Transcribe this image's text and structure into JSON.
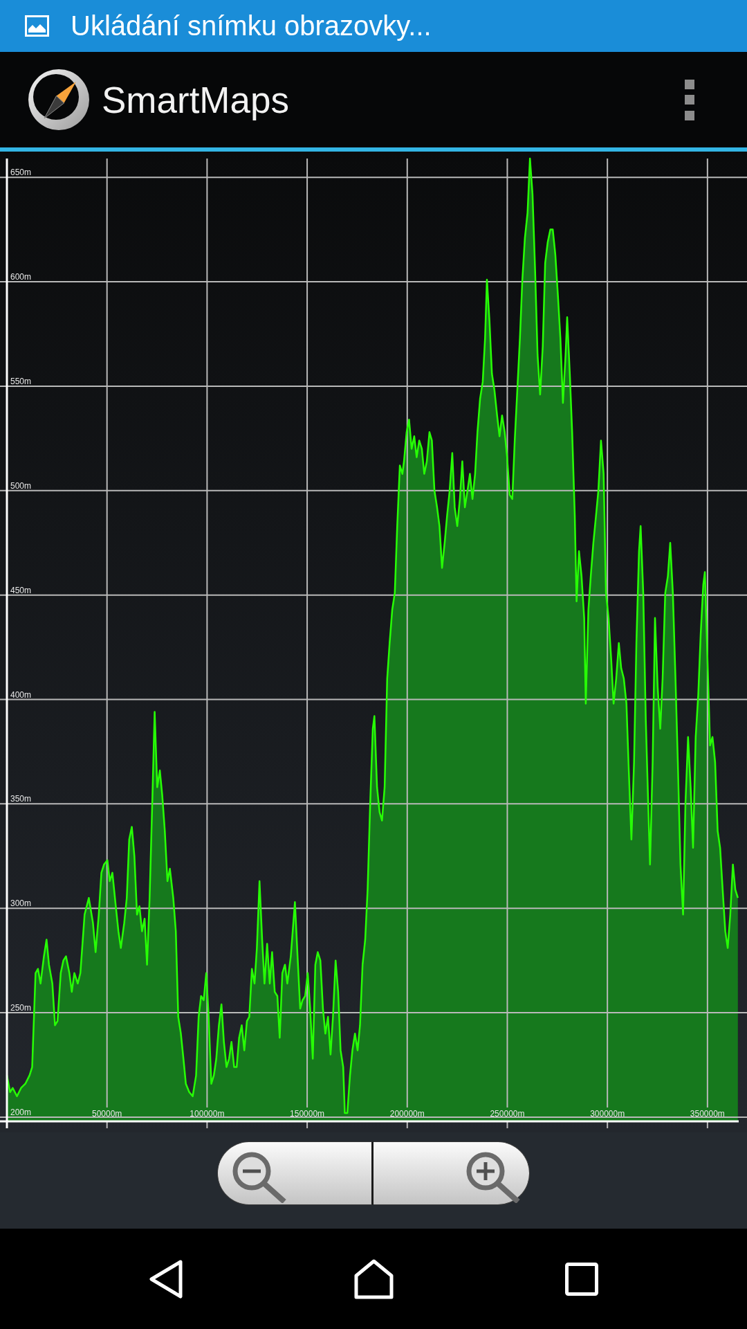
{
  "status_bar": {
    "notification": "Ukládání snímku obrazovky..."
  },
  "app_bar": {
    "title": "SmartMaps"
  },
  "elevation_chart": {
    "chart_data": {
      "type": "area",
      "grid": true,
      "xlim": [
        0,
        365600
      ],
      "ylim": [
        198,
        661
      ],
      "xticks": [
        {
          "value": 50000,
          "label": "50000m"
        },
        {
          "value": 100000,
          "label": "100000m"
        },
        {
          "value": 150000,
          "label": "150000m"
        },
        {
          "value": 200000,
          "label": "200000m"
        },
        {
          "value": 250000,
          "label": "250000m"
        },
        {
          "value": 300000,
          "label": "300000m"
        },
        {
          "value": 350000,
          "label": "350000m"
        }
      ],
      "yticks": [
        {
          "value": 200,
          "label": "200m"
        },
        {
          "value": 250,
          "label": "250m"
        },
        {
          "value": 300,
          "label": "300m"
        },
        {
          "value": 350,
          "label": "350m"
        },
        {
          "value": 400,
          "label": "400m"
        },
        {
          "value": 450,
          "label": "450m"
        },
        {
          "value": 500,
          "label": "500m"
        },
        {
          "value": 550,
          "label": "550m"
        },
        {
          "value": 600,
          "label": "600m"
        },
        {
          "value": 650,
          "label": "650m"
        }
      ],
      "x": [
        0,
        1600,
        2900,
        5000,
        7100,
        9200,
        11300,
        12600,
        14300,
        15500,
        16800,
        18500,
        19800,
        21000,
        22700,
        24000,
        25300,
        26900,
        28200,
        29500,
        31200,
        32400,
        33700,
        35400,
        36700,
        38800,
        40900,
        43000,
        44300,
        45900,
        47200,
        48500,
        50200,
        51400,
        52700,
        54400,
        55700,
        56900,
        58600,
        59900,
        61100,
        62400,
        63700,
        65000,
        66200,
        67500,
        68800,
        70000,
        71300,
        72600,
        73800,
        75100,
        76400,
        77600,
        78900,
        80200,
        81400,
        83100,
        84400,
        85600,
        86900,
        88200,
        89400,
        91100,
        92800,
        94500,
        95800,
        97000,
        98300,
        99600,
        100800,
        102100,
        103400,
        104600,
        105900,
        107200,
        108400,
        109700,
        111000,
        112200,
        113500,
        114800,
        116000,
        117300,
        118600,
        119900,
        121100,
        122400,
        123700,
        124900,
        126200,
        127500,
        128700,
        130000,
        131300,
        132500,
        133800,
        135100,
        136300,
        137600,
        138900,
        140100,
        141800,
        143100,
        143900,
        145200,
        146500,
        147700,
        149000,
        150300,
        151500,
        152800,
        154100,
        155300,
        156600,
        157900,
        159100,
        160400,
        161700,
        162900,
        164200,
        165500,
        166700,
        168000,
        168800,
        170100,
        171400,
        172600,
        173900,
        175200,
        176400,
        177700,
        179000,
        180200,
        181500,
        182800,
        183600,
        184900,
        186200,
        187400,
        188700,
        190000,
        191200,
        192500,
        193800,
        195000,
        196300,
        197600,
        198400,
        199700,
        200900,
        202200,
        203500,
        204700,
        206000,
        207300,
        208500,
        209800,
        211100,
        212300,
        213600,
        214900,
        216100,
        217400,
        218700,
        219900,
        221200,
        222500,
        223700,
        225000,
        226300,
        227500,
        228800,
        230100,
        231300,
        232600,
        233900,
        235100,
        236400,
        237700,
        238900,
        239800,
        241100,
        242300,
        243600,
        244900,
        246100,
        247400,
        248700,
        249900,
        251200,
        252500,
        253700,
        255000,
        256300,
        257500,
        258800,
        260100,
        261300,
        262600,
        263900,
        265100,
        266400,
        267700,
        268900,
        270200,
        271500,
        272700,
        274000,
        275300,
        276500,
        277800,
        279100,
        279900,
        281200,
        282400,
        283700,
        284600,
        285800,
        287100,
        288400,
        289200,
        290500,
        291700,
        293000,
        294300,
        295500,
        296800,
        298100,
        299300,
        300600,
        301900,
        303100,
        304400,
        305700,
        306900,
        308200,
        309500,
        310700,
        312000,
        313300,
        314500,
        315800,
        316600,
        317900,
        319200,
        320500,
        321300,
        322600,
        323800,
        325100,
        326400,
        327600,
        328900,
        330200,
        331400,
        332700,
        334000,
        335200,
        336500,
        337800,
        339000,
        340300,
        341600,
        342800,
        344100,
        345400,
        346600,
        347900,
        348700,
        350000,
        351300,
        352500,
        353800,
        355100,
        356300,
        357600,
        358900,
        360100,
        361400,
        362700,
        363900,
        365200
      ],
      "series": [
        {
          "color": "#27ff05",
          "values": [
            220,
            212,
            214,
            210,
            214,
            216,
            220,
            224,
            269,
            271,
            264,
            277,
            285,
            273,
            264,
            244,
            246,
            269,
            275,
            277,
            269,
            260,
            269,
            264,
            269,
            297,
            305,
            293,
            279,
            297,
            317,
            321,
            323,
            313,
            317,
            301,
            289,
            281,
            293,
            305,
            333,
            339,
            325,
            297,
            301,
            289,
            295,
            273,
            305,
            350,
            394,
            358,
            366,
            354,
            337,
            313,
            319,
            305,
            289,
            248,
            240,
            228,
            216,
            212,
            210,
            220,
            248,
            258,
            256,
            269,
            248,
            216,
            220,
            228,
            244,
            254,
            236,
            224,
            228,
            236,
            224,
            224,
            238,
            244,
            232,
            246,
            248,
            271,
            264,
            281,
            313,
            285,
            264,
            283,
            264,
            279,
            260,
            258,
            238,
            269,
            273,
            264,
            277,
            293,
            303,
            277,
            252,
            256,
            258,
            269,
            252,
            228,
            273,
            279,
            275,
            252,
            240,
            248,
            230,
            248,
            275,
            260,
            232,
            224,
            202,
            202,
            220,
            232,
            240,
            232,
            244,
            273,
            285,
            309,
            350,
            386,
            392,
            358,
            346,
            342,
            358,
            410,
            427,
            443,
            451,
            483,
            512,
            508,
            514,
            528,
            534,
            520,
            526,
            516,
            524,
            520,
            508,
            514,
            528,
            524,
            500,
            492,
            483,
            463,
            475,
            488,
            500,
            518,
            492,
            483,
            496,
            514,
            492,
            500,
            508,
            496,
            508,
            528,
            544,
            552,
            573,
            601,
            581,
            556,
            548,
            536,
            526,
            536,
            528,
            516,
            498,
            496,
            524,
            548,
            573,
            601,
            621,
            633,
            659,
            642,
            605,
            565,
            546,
            569,
            609,
            619,
            625,
            625,
            613,
            593,
            573,
            542,
            565,
            583,
            556,
            528,
            488,
            447,
            471,
            459,
            439,
            398,
            443,
            459,
            475,
            488,
            500,
            524,
            508,
            451,
            439,
            419,
            398,
            410,
            427,
            415,
            410,
            398,
            366,
            333,
            370,
            427,
            471,
            483,
            451,
            390,
            346,
            321,
            370,
            439,
            406,
            386,
            410,
            451,
            459,
            475,
            451,
            410,
            370,
            321,
            297,
            350,
            382,
            358,
            329,
            382,
            402,
            431,
            455,
            461,
            419,
            378,
            382,
            370,
            337,
            329,
            309,
            289,
            281,
            297,
            321,
            309,
            305
          ]
        }
      ]
    }
  }
}
